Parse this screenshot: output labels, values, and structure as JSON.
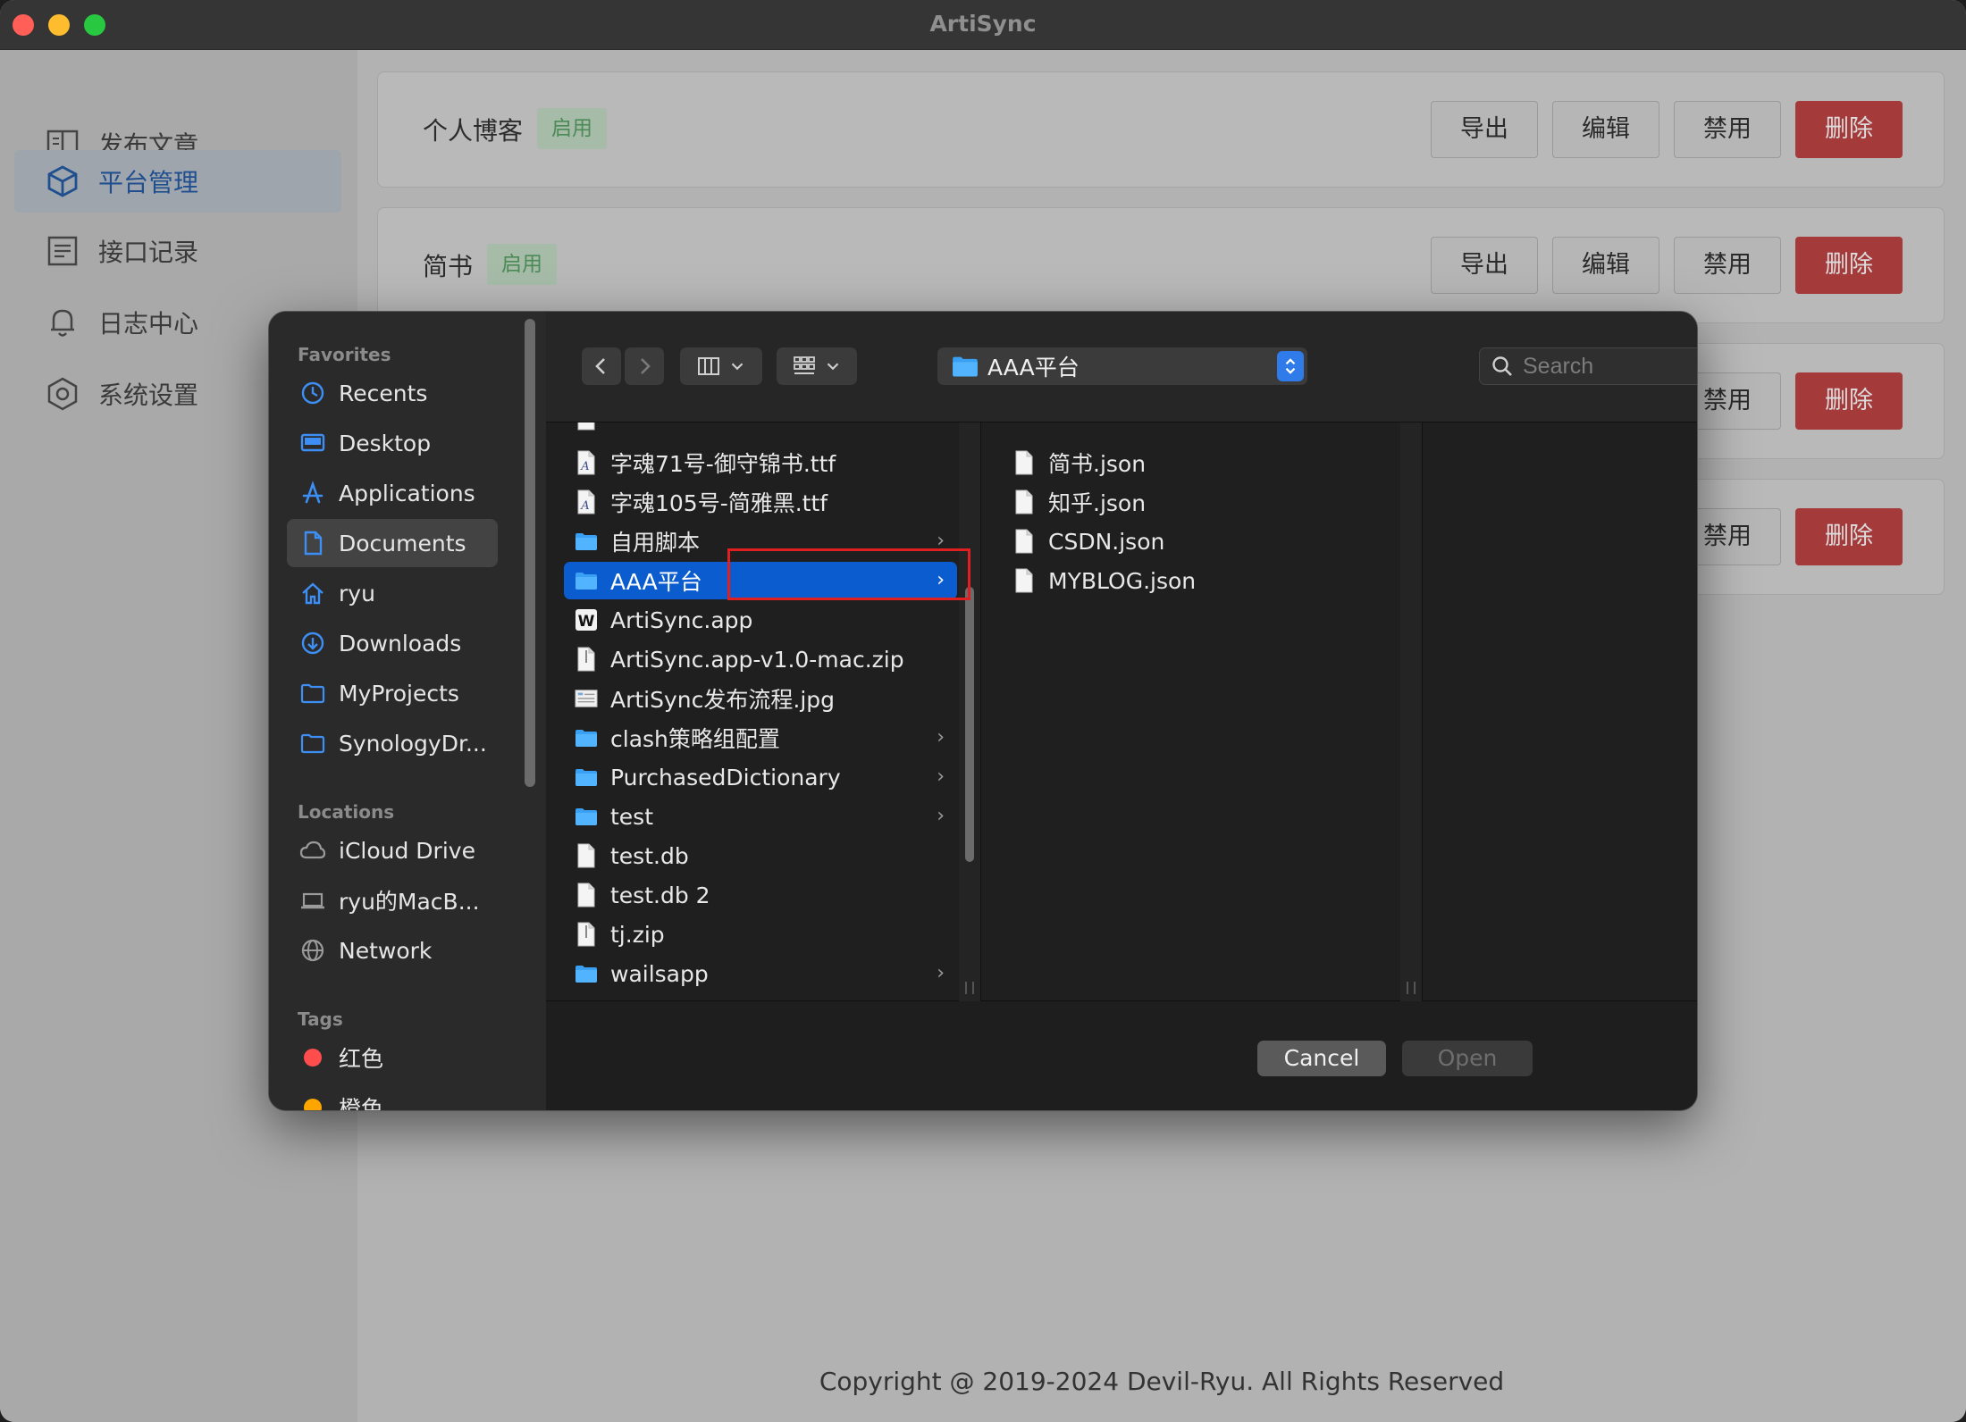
{
  "window": {
    "title": "ArtiSync"
  },
  "sidebar": {
    "items": [
      {
        "label": "发布文章",
        "icon": "book-icon"
      },
      {
        "label": "平台管理",
        "icon": "cube-icon",
        "active": true
      },
      {
        "label": "接口记录",
        "icon": "list-icon"
      },
      {
        "label": "日志中心",
        "icon": "bell-icon"
      },
      {
        "label": "系统设置",
        "icon": "settings-icon"
      }
    ]
  },
  "platforms": [
    {
      "name": "个人博客",
      "status": "启用"
    },
    {
      "name": "简书",
      "status": "启用"
    }
  ],
  "card_actions": {
    "export": "导出",
    "edit": "编辑",
    "disable": "禁用",
    "delete": "删除"
  },
  "copyright": "Copyright @ 2019-2024 Devil-Ryu. All Rights Reserved",
  "dialog": {
    "favorites_header": "Favorites",
    "favorites": [
      {
        "label": "Recents",
        "icon": "clock-icon"
      },
      {
        "label": "Desktop",
        "icon": "desktop-icon"
      },
      {
        "label": "Applications",
        "icon": "applications-icon"
      },
      {
        "label": "Documents",
        "icon": "document-icon",
        "selected": true
      },
      {
        "label": "ryu",
        "icon": "home-icon"
      },
      {
        "label": "Downloads",
        "icon": "download-icon"
      },
      {
        "label": "MyProjects",
        "icon": "folder-icon"
      },
      {
        "label": "SynologyDr...",
        "icon": "folder-icon"
      }
    ],
    "locations_header": "Locations",
    "locations": [
      {
        "label": "iCloud Drive",
        "icon": "cloud-icon"
      },
      {
        "label": "ryu的MacB...",
        "icon": "laptop-icon"
      },
      {
        "label": "Network",
        "icon": "globe-icon"
      }
    ],
    "tags_header": "Tags",
    "tags": [
      {
        "label": "红色",
        "color": "#ff4d4d"
      },
      {
        "label": "橙色",
        "color": "#ffa500"
      }
    ],
    "path": "AAA平台",
    "search_placeholder": "Search",
    "column1": [
      {
        "name": "字魂71号-御守锦书.ttf",
        "icon": "font-file-icon"
      },
      {
        "name": "字魂105号-简雅黑.ttf",
        "icon": "font-file-icon"
      },
      {
        "name": "自用脚本",
        "icon": "folder-icon",
        "chevron": "›"
      },
      {
        "name": "AAA平台",
        "icon": "folder-icon",
        "chevron": "›",
        "selected": true
      },
      {
        "name": "ArtiSync.app",
        "icon": "app-icon"
      },
      {
        "name": "ArtiSync.app-v1.0-mac.zip",
        "icon": "zip-file-icon"
      },
      {
        "name": "ArtiSync发布流程.jpg",
        "icon": "image-file-icon"
      },
      {
        "name": "clash策略组配置",
        "icon": "folder-icon",
        "chevron": "›"
      },
      {
        "name": "PurchasedDictionary",
        "icon": "folder-icon",
        "chevron": "›"
      },
      {
        "name": "test",
        "icon": "folder-icon",
        "chevron": "›"
      },
      {
        "name": "test.db",
        "icon": "file-icon"
      },
      {
        "name": "test.db 2",
        "icon": "file-icon"
      },
      {
        "name": "tj.zip",
        "icon": "zip-file-icon"
      },
      {
        "name": "wailsapp",
        "icon": "folder-icon",
        "chevron": "›"
      }
    ],
    "column2": [
      {
        "name": "简书.json",
        "icon": "file-icon"
      },
      {
        "name": "知乎.json",
        "icon": "file-icon"
      },
      {
        "name": "CSDN.json",
        "icon": "file-icon"
      },
      {
        "name": "MYBLOG.json",
        "icon": "file-icon"
      }
    ],
    "cancel": "Cancel",
    "open": "Open"
  }
}
